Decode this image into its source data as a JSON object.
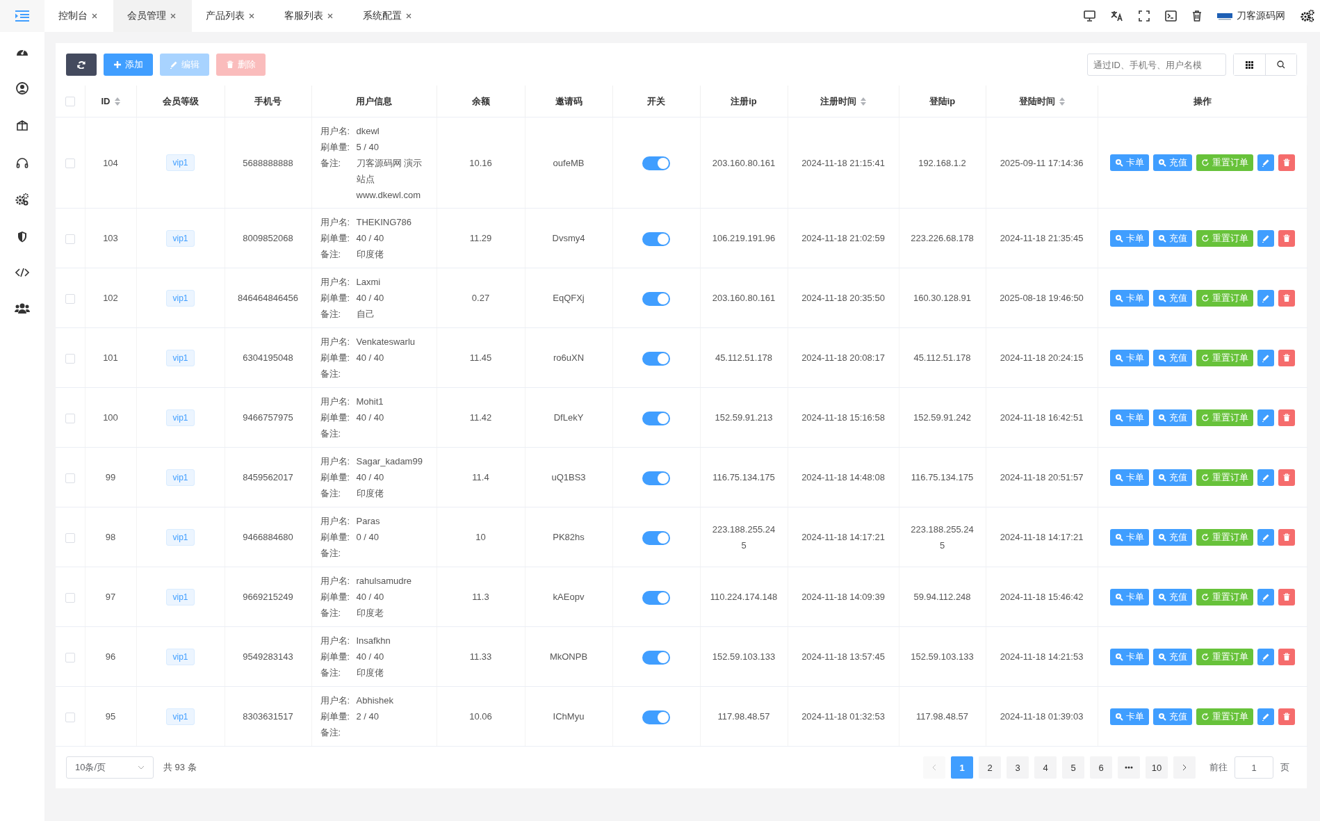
{
  "topbar": {
    "tabs": [
      {
        "label": "控制台",
        "selected": false
      },
      {
        "label": "会员管理",
        "selected": true
      },
      {
        "label": "产品列表",
        "selected": false
      },
      {
        "label": "客服列表",
        "selected": false
      },
      {
        "label": "系统配置",
        "selected": false
      }
    ],
    "site_name": "刀客源码网"
  },
  "toolbar": {
    "buttons": [
      {
        "kind": "refresh",
        "disabled": false
      },
      {
        "kind": "add",
        "label": "添加",
        "disabled": false
      },
      {
        "kind": "edit",
        "label": "编辑",
        "disabled": true
      },
      {
        "kind": "delete",
        "label": "删除",
        "disabled": true
      }
    ],
    "search": {
      "placeholder": "通过ID、手机号、用户名模"
    }
  },
  "table": {
    "select_all_checked": false,
    "columns": [
      {
        "label": "ID",
        "sortable": true
      },
      {
        "label": "会员等级",
        "sortable": false
      },
      {
        "label": "手机号",
        "sortable": false
      },
      {
        "label": "用户信息",
        "sortable": false
      },
      {
        "label": "余额",
        "sortable": false
      },
      {
        "label": "邀请码",
        "sortable": false
      },
      {
        "label": "开关",
        "sortable": false
      },
      {
        "label": "注册ip",
        "sortable": false
      },
      {
        "label": "注册时间",
        "sortable": true
      },
      {
        "label": "登陆ip",
        "sortable": false
      },
      {
        "label": "登陆时间",
        "sortable": true
      },
      {
        "label": "操作",
        "sortable": false
      }
    ],
    "rows": [
      {
        "checked": false,
        "id": "104",
        "member_level": "vip1",
        "phone": "5688888888",
        "user_info": [
          {
            "label": "用户名:",
            "value": "dkewl"
          },
          {
            "label": "刷单量:",
            "value": "5 / 40"
          },
          {
            "label": "备注:",
            "value": "刀客源码网 演示站点 www.dkewl.com"
          }
        ],
        "balance": "10.16",
        "invite_code": "oufeMB",
        "switch_on": true,
        "reg_ip": "203.160.80.161",
        "reg_time": "2024-11-18 21:15:41",
        "login_ip": "192.168.1.2",
        "login_time": "2025-09-11 17:14:36",
        "actions": [
          {
            "kind": "lookup",
            "label": "卡单"
          },
          {
            "kind": "lookup",
            "label": "充值"
          },
          {
            "kind": "reset",
            "label": "重置订单"
          },
          {
            "kind": "edit"
          },
          {
            "kind": "delete"
          }
        ]
      },
      {
        "checked": false,
        "id": "103",
        "member_level": "vip1",
        "phone": "8009852068",
        "user_info": [
          {
            "label": "用户名:",
            "value": "THEKING786"
          },
          {
            "label": "刷单量:",
            "value": "40 / 40"
          },
          {
            "label": "备注:",
            "value": "印度佬"
          }
        ],
        "balance": "11.29",
        "invite_code": "Dvsmy4",
        "switch_on": true,
        "reg_ip": "106.219.191.96",
        "reg_time": "2024-11-18 21:02:59",
        "login_ip": "223.226.68.178",
        "login_time": "2024-11-18 21:35:45",
        "actions": [
          {
            "kind": "lookup",
            "label": "卡单"
          },
          {
            "kind": "lookup",
            "label": "充值"
          },
          {
            "kind": "reset",
            "label": "重置订单"
          },
          {
            "kind": "edit"
          },
          {
            "kind": "delete"
          }
        ]
      },
      {
        "checked": false,
        "id": "102",
        "member_level": "vip1",
        "phone": "846464846456",
        "user_info": [
          {
            "label": "用户名:",
            "value": "Laxmi"
          },
          {
            "label": "刷单量:",
            "value": "40 / 40"
          },
          {
            "label": "备注:",
            "value": "自己"
          }
        ],
        "balance": "0.27",
        "invite_code": "EqQFXj",
        "switch_on": true,
        "reg_ip": "203.160.80.161",
        "reg_time": "2024-11-18 20:35:50",
        "login_ip": "160.30.128.91",
        "login_time": "2025-08-18 19:46:50",
        "actions": [
          {
            "kind": "lookup",
            "label": "卡单"
          },
          {
            "kind": "lookup",
            "label": "充值"
          },
          {
            "kind": "reset",
            "label": "重置订单"
          },
          {
            "kind": "edit"
          },
          {
            "kind": "delete"
          }
        ]
      },
      {
        "checked": false,
        "id": "101",
        "member_level": "vip1",
        "phone": "6304195048",
        "user_info": [
          {
            "label": "用户名:",
            "value": "Venkateswarlu"
          },
          {
            "label": "刷单量:",
            "value": "40 / 40"
          },
          {
            "label": "备注:"
          }
        ],
        "balance": "11.45",
        "invite_code": "ro6uXN",
        "switch_on": true,
        "reg_ip": "45.112.51.178",
        "reg_time": "2024-11-18 20:08:17",
        "login_ip": "45.112.51.178",
        "login_time": "2024-11-18 20:24:15",
        "actions": [
          {
            "kind": "lookup",
            "label": "卡单"
          },
          {
            "kind": "lookup",
            "label": "充值"
          },
          {
            "kind": "reset",
            "label": "重置订单"
          },
          {
            "kind": "edit"
          },
          {
            "kind": "delete"
          }
        ]
      },
      {
        "checked": false,
        "id": "100",
        "member_level": "vip1",
        "phone": "9466757975",
        "user_info": [
          {
            "label": "用户名:",
            "value": "Mohit1"
          },
          {
            "label": "刷单量:",
            "value": "40 / 40"
          },
          {
            "label": "备注:"
          }
        ],
        "balance": "11.42",
        "invite_code": "DfLekY",
        "switch_on": true,
        "reg_ip": "152.59.91.213",
        "reg_time": "2024-11-18 15:16:58",
        "login_ip": "152.59.91.242",
        "login_time": "2024-11-18 16:42:51",
        "actions": [
          {
            "kind": "lookup",
            "label": "卡单"
          },
          {
            "kind": "lookup",
            "label": "充值"
          },
          {
            "kind": "reset",
            "label": "重置订单"
          },
          {
            "kind": "edit"
          },
          {
            "kind": "delete"
          }
        ]
      },
      {
        "checked": false,
        "id": "99",
        "member_level": "vip1",
        "phone": "8459562017",
        "user_info": [
          {
            "label": "用户名:",
            "value": "Sagar_kadam99"
          },
          {
            "label": "刷单量:",
            "value": "40 / 40"
          },
          {
            "label": "备注:",
            "value": "印度佬"
          }
        ],
        "balance": "11.4",
        "invite_code": "uQ1BS3",
        "switch_on": true,
        "reg_ip": "116.75.134.175",
        "reg_time": "2024-11-18 14:48:08",
        "login_ip": "116.75.134.175",
        "login_time": "2024-11-18 20:51:57",
        "actions": [
          {
            "kind": "lookup",
            "label": "卡单"
          },
          {
            "kind": "lookup",
            "label": "充值"
          },
          {
            "kind": "reset",
            "label": "重置订单"
          },
          {
            "kind": "edit"
          },
          {
            "kind": "delete"
          }
        ]
      },
      {
        "checked": false,
        "id": "98",
        "member_level": "vip1",
        "phone": "9466884680",
        "user_info": [
          {
            "label": "用户名:",
            "value": "Paras"
          },
          {
            "label": "刷单量:",
            "value": "0 / 40"
          },
          {
            "label": "备注:"
          }
        ],
        "balance": "10",
        "invite_code": "PK82hs",
        "switch_on": true,
        "reg_ip": "223.188.255.245",
        "reg_time": "2024-11-18 14:17:21",
        "login_ip": "223.188.255.245",
        "login_time": "2024-11-18 14:17:21",
        "actions": [
          {
            "kind": "lookup",
            "label": "卡单"
          },
          {
            "kind": "lookup",
            "label": "充值"
          },
          {
            "kind": "reset",
            "label": "重置订单"
          },
          {
            "kind": "edit"
          },
          {
            "kind": "delete"
          }
        ]
      },
      {
        "checked": false,
        "id": "97",
        "member_level": "vip1",
        "phone": "9669215249",
        "user_info": [
          {
            "label": "用户名:",
            "value": "rahulsamudre"
          },
          {
            "label": "刷单量:",
            "value": "40 / 40"
          },
          {
            "label": "备注:",
            "value": "印度老"
          }
        ],
        "balance": "11.3",
        "invite_code": "kAEopv",
        "switch_on": true,
        "reg_ip": "110.224.174.148",
        "reg_time": "2024-11-18 14:09:39",
        "login_ip": "59.94.112.248",
        "login_time": "2024-11-18 15:46:42",
        "actions": [
          {
            "kind": "lookup",
            "label": "卡单"
          },
          {
            "kind": "lookup",
            "label": "充值"
          },
          {
            "kind": "reset",
            "label": "重置订单"
          },
          {
            "kind": "edit"
          },
          {
            "kind": "delete"
          }
        ]
      },
      {
        "checked": false,
        "id": "96",
        "member_level": "vip1",
        "phone": "9549283143",
        "user_info": [
          {
            "label": "用户名:",
            "value": "Insafkhn"
          },
          {
            "label": "刷单量:",
            "value": "40 / 40"
          },
          {
            "label": "备注:",
            "value": "印度佬"
          }
        ],
        "balance": "11.33",
        "invite_code": "MkONPB",
        "switch_on": true,
        "reg_ip": "152.59.103.133",
        "reg_time": "2024-11-18 13:57:45",
        "login_ip": "152.59.103.133",
        "login_time": "2024-11-18 14:21:53",
        "actions": [
          {
            "kind": "lookup",
            "label": "卡单"
          },
          {
            "kind": "lookup",
            "label": "充值"
          },
          {
            "kind": "reset",
            "label": "重置订单"
          },
          {
            "kind": "edit"
          },
          {
            "kind": "delete"
          }
        ]
      },
      {
        "checked": false,
        "id": "95",
        "member_level": "vip1",
        "phone": "8303631517",
        "user_info": [
          {
            "label": "用户名:",
            "value": "Abhishek"
          },
          {
            "label": "刷单量:",
            "value": "2 / 40"
          },
          {
            "label": "备注:"
          }
        ],
        "balance": "10.06",
        "invite_code": "IChMyu",
        "switch_on": true,
        "reg_ip": "117.98.48.57",
        "reg_time": "2024-11-18 01:32:53",
        "login_ip": "117.98.48.57",
        "login_time": "2024-11-18 01:39:03",
        "actions": [
          {
            "kind": "lookup",
            "label": "卡单"
          },
          {
            "kind": "lookup",
            "label": "充值"
          },
          {
            "kind": "reset",
            "label": "重置订单"
          },
          {
            "kind": "edit"
          },
          {
            "kind": "delete"
          }
        ]
      }
    ]
  },
  "pagination": {
    "page_size": "10条/页",
    "total": "共 93 条",
    "prev_disabled": true,
    "pages": [
      {
        "kind": "page",
        "label": "1",
        "selected": true
      },
      {
        "kind": "page",
        "label": "2",
        "selected": false
      },
      {
        "kind": "page",
        "label": "3",
        "selected": false
      },
      {
        "kind": "page",
        "label": "4",
        "selected": false
      },
      {
        "kind": "page",
        "label": "5",
        "selected": false
      },
      {
        "kind": "page",
        "label": "6",
        "selected": false
      },
      {
        "kind": "more",
        "selected": false
      },
      {
        "kind": "page",
        "label": "10",
        "selected": false
      }
    ],
    "goto_label": "前往",
    "goto_value": "1",
    "goto_suffix": "页"
  }
}
